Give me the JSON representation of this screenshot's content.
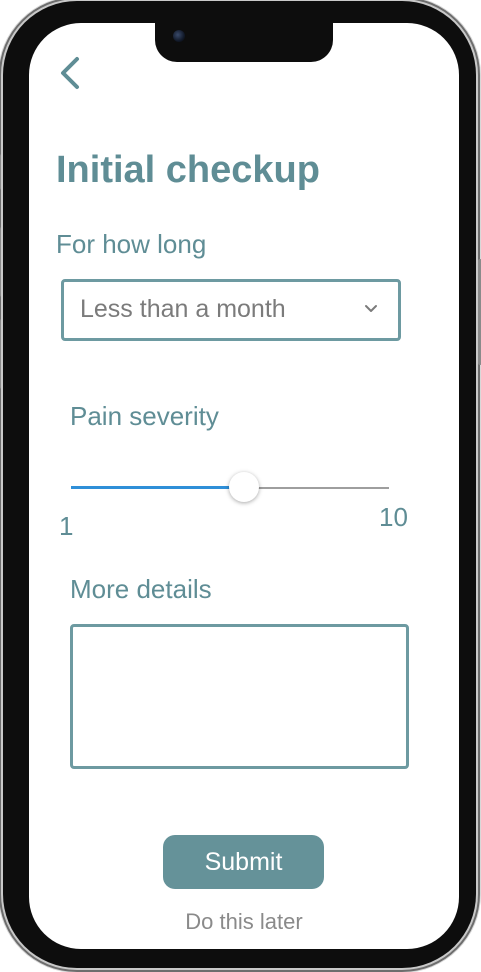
{
  "header": {
    "back_icon": "chevron-left-icon",
    "title": "Initial checkup"
  },
  "duration": {
    "label": "For how long",
    "selected": "Less than a month",
    "icon": "chevron-down-icon"
  },
  "pain": {
    "label": "Pain severity",
    "min_label": "1",
    "max_label": "10",
    "min": 1,
    "max": 10,
    "value": 5.9
  },
  "details": {
    "label": "More details",
    "value": ""
  },
  "actions": {
    "submit_label": "Submit",
    "later_label": "Do this later"
  },
  "colors": {
    "accent": "#5f8d95",
    "button": "#659299",
    "slider_fill": "#2f8fd8"
  }
}
